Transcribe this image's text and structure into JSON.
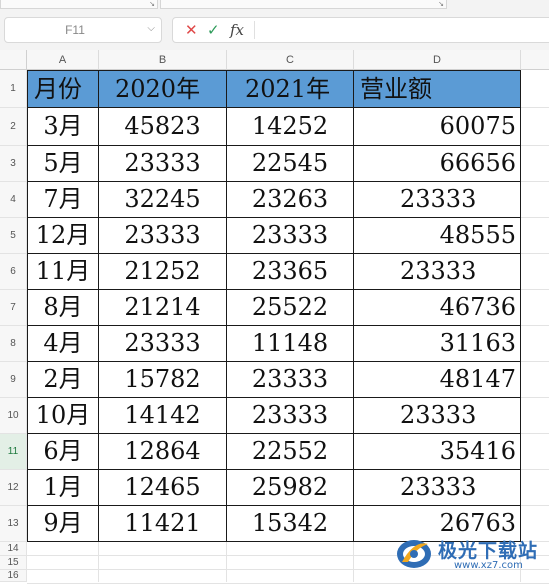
{
  "formula_bar": {
    "name_box": "F11",
    "cancel_icon": "✕",
    "confirm_icon": "✓",
    "fx_label": "fx",
    "formula": ""
  },
  "columns": [
    "A",
    "B",
    "C",
    "D"
  ],
  "row_numbers": [
    "1",
    "2",
    "3",
    "4",
    "5",
    "6",
    "7",
    "8",
    "9",
    "10",
    "11",
    "12",
    "13",
    "14",
    "15",
    "16"
  ],
  "active_row": "11",
  "table": {
    "header": [
      "月份",
      "2020年",
      "2021年",
      "营业额"
    ],
    "rows": [
      {
        "month": "3月",
        "y2020": "45823",
        "y2021": "14252",
        "revenue": "60075",
        "align": "right"
      },
      {
        "month": "5月",
        "y2020": "23333",
        "y2021": "22545",
        "revenue": "66656",
        "align": "right"
      },
      {
        "month": "7月",
        "y2020": "32245",
        "y2021": "23263",
        "revenue": "23333",
        "align": "left"
      },
      {
        "month": "12月",
        "y2020": "23333",
        "y2021": "23333",
        "revenue": "48555",
        "align": "right"
      },
      {
        "month": "11月",
        "y2020": "21252",
        "y2021": "23365",
        "revenue": "23333",
        "align": "left"
      },
      {
        "month": "8月",
        "y2020": "21214",
        "y2021": "25522",
        "revenue": "46736",
        "align": "right"
      },
      {
        "month": "4月",
        "y2020": "23333",
        "y2021": "11148",
        "revenue": "31163",
        "align": "right"
      },
      {
        "month": "2月",
        "y2020": "15782",
        "y2021": "23333",
        "revenue": "48147",
        "align": "right"
      },
      {
        "month": "10月",
        "y2020": "14142",
        "y2021": "23333",
        "revenue": "23333",
        "align": "left"
      },
      {
        "month": "6月",
        "y2020": "12864",
        "y2021": "22552",
        "revenue": "35416",
        "align": "right"
      },
      {
        "month": "1月",
        "y2020": "12465",
        "y2021": "25982",
        "revenue": "23333",
        "align": "left"
      },
      {
        "month": "9月",
        "y2020": "11421",
        "y2021": "15342",
        "revenue": "26763",
        "align": "right"
      }
    ]
  },
  "colors": {
    "header_fill": "#5b9bd5",
    "active_row_header": "#e3efe6",
    "brand": "#2f6db5"
  },
  "watermark": {
    "text": "极光下载站",
    "url": "www.xz7.com"
  }
}
